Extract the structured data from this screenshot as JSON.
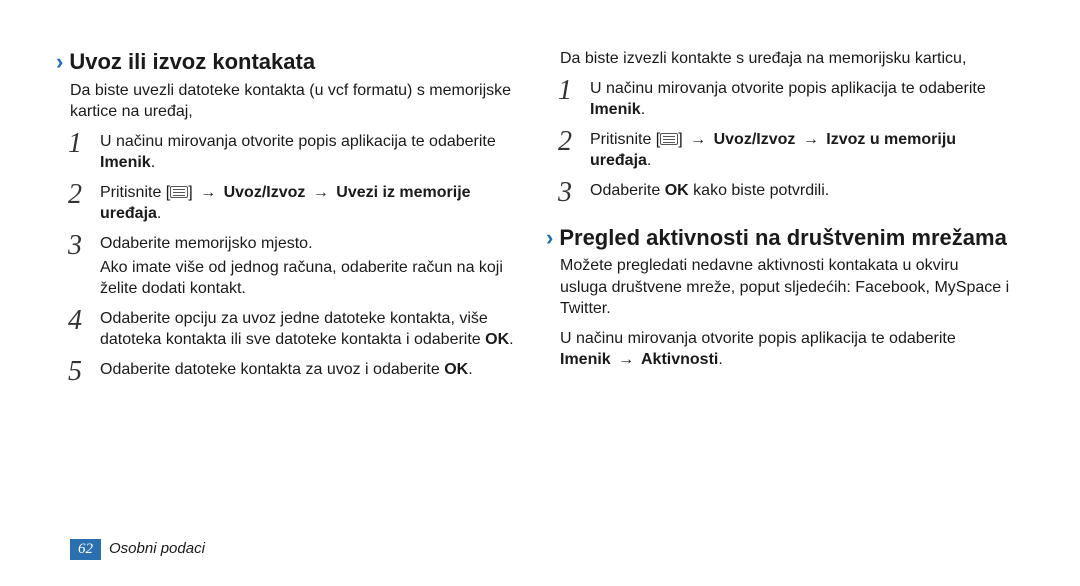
{
  "left": {
    "heading": "Uvoz ili izvoz kontakata",
    "intro": "Da biste uvezli datoteke kontakta (u vcf formatu) s memorijske kartice na uređaj,",
    "steps": [
      {
        "text": "U načinu mirovanja otvorite popis aplikacija te odaberite ",
        "bold1": "Imenik",
        "suffix": "."
      },
      {
        "text": "Pritisnite [",
        "icon": true,
        "after_icon": "] ",
        "arrow1": "→",
        "bold1": " Uvoz/Izvoz ",
        "arrow2": "→",
        "bold2": " Uvezi iz memorije uređaja",
        "suffix": "."
      },
      {
        "text": "Odaberite memorijsko mjesto.",
        "sub": "Ako imate više od jednog računa, odaberite račun na koji želite dodati kontakt."
      },
      {
        "text": "Odaberite opciju za uvoz jedne datoteke kontakta, više datoteka kontakta ili sve datoteke kontakta i odaberite ",
        "bold1": "OK",
        "suffix": "."
      },
      {
        "text": "Odaberite datoteke kontakta za uvoz i odaberite ",
        "bold1": "OK",
        "suffix": "."
      }
    ]
  },
  "right": {
    "intro_top": "Da biste izvezli kontakte s uređaja na memorijsku karticu,",
    "steps": [
      {
        "text": "U načinu mirovanja otvorite popis aplikacija te odaberite ",
        "bold1": "Imenik",
        "suffix": "."
      },
      {
        "text": "Pritisnite [",
        "icon": true,
        "after_icon": "] ",
        "arrow1": "→",
        "bold1": " Uvoz/Izvoz ",
        "arrow2": "→",
        "bold2": " Izvoz u memoriju uređaja",
        "suffix": "."
      },
      {
        "text": "Odaberite ",
        "bold1": "OK",
        "suffix": " kako biste potvrdili."
      }
    ],
    "heading2": "Pregled aktivnosti na društvenim mrežama",
    "para2": "Možete pregledati nedavne aktivnosti kontakata u okviru usluga društvene mreže, poput sljedećih: Facebook, MySpace i Twitter.",
    "para3a": "U načinu mirovanja otvorite popis aplikacija te odaberite ",
    "para3b": "Imenik ",
    "para3_arrow": "→",
    "para3c": " Aktivnosti",
    "para3_suffix": "."
  },
  "footer": {
    "page": "62",
    "section": "Osobni podaci"
  }
}
